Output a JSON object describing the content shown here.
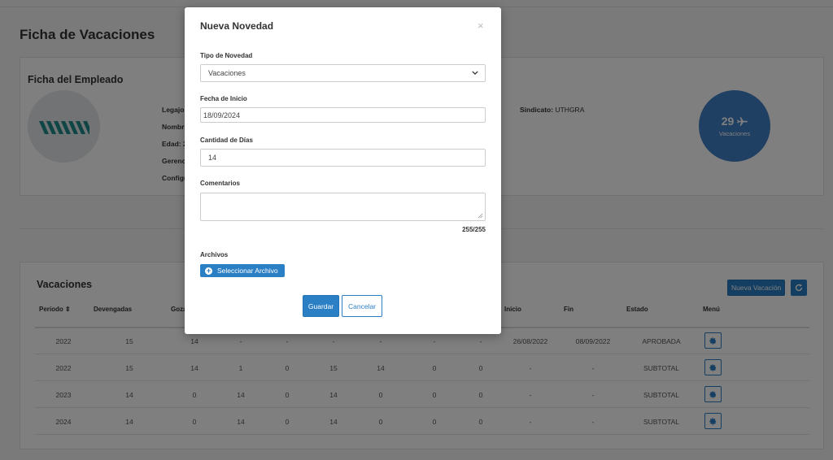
{
  "page": {
    "title": "Ficha de Vacaciones"
  },
  "employee_card": {
    "title": "Ficha del Empleado",
    "fields": [
      {
        "label": "Legajo:",
        "value": ""
      },
      {
        "label": "Nombre",
        "value": ""
      },
      {
        "label": "Edad: 2",
        "value": ""
      },
      {
        "label": "Gerenc",
        "value": ""
      },
      {
        "label": "Configu",
        "value": ""
      }
    ],
    "sindicato_label": "Sindicato:",
    "sindicato_value": "UTHGRA",
    "vacation_count": "29",
    "vacation_count_label": "Vacaciones",
    "plane_icon": "airplane-icon"
  },
  "vacaciones": {
    "title": "Vacaciones",
    "new_button": "Nueva Vacación",
    "refresh_icon": "refresh-icon",
    "headers": [
      "Período ⇕",
      "Devengadas",
      "Goza",
      "Inicio",
      "Fin",
      "Estado",
      "Menú"
    ],
    "rows": [
      {
        "periodo": "2022",
        "devengadas": "15",
        "c3": "14",
        "c4": "-",
        "c5": "-",
        "c6": "-",
        "c7": "-",
        "c8": "-",
        "c9": "-",
        "inicio": "26/08/2022",
        "fin": "08/09/2022",
        "estado": "APROBADA"
      },
      {
        "periodo": "2022",
        "devengadas": "15",
        "c3": "14",
        "c4": "1",
        "c5": "0",
        "c6": "15",
        "c7": "14",
        "c8": "0",
        "c9": "0",
        "inicio": "-",
        "fin": "-",
        "estado": "SUBTOTAL"
      },
      {
        "periodo": "2023",
        "devengadas": "14",
        "c3": "0",
        "c4": "14",
        "c5": "0",
        "c6": "14",
        "c7": "0",
        "c8": "0",
        "c9": "0",
        "inicio": "-",
        "fin": "-",
        "estado": "SUBTOTAL"
      },
      {
        "periodo": "2024",
        "devengadas": "14",
        "c3": "0",
        "c4": "14",
        "c5": "0",
        "c6": "14",
        "c7": "0",
        "c8": "0",
        "c9": "0",
        "inicio": "-",
        "fin": "-",
        "estado": "SUBTOTAL"
      }
    ]
  },
  "modal": {
    "title": "Nueva Novedad",
    "close": "×",
    "tipo_label": "Tipo de Novedad",
    "tipo_value": "Vacaciones",
    "fecha_label": "Fecha de Inicio",
    "fecha_value": "18/09/2024",
    "dias_label": "Cantidad de Días",
    "dias_value": "14",
    "comentarios_label": "Comentarios",
    "comentarios_value": "",
    "counter": "255/255",
    "archivos_label": "Archivos",
    "file_button": "Seleccionar Archivo",
    "save_button": "Guardar",
    "cancel_button": "Cancelar"
  },
  "colors": {
    "primary": "#2b7fc4",
    "circle": "#3f7fc6",
    "logo": "#1f8a8a"
  }
}
